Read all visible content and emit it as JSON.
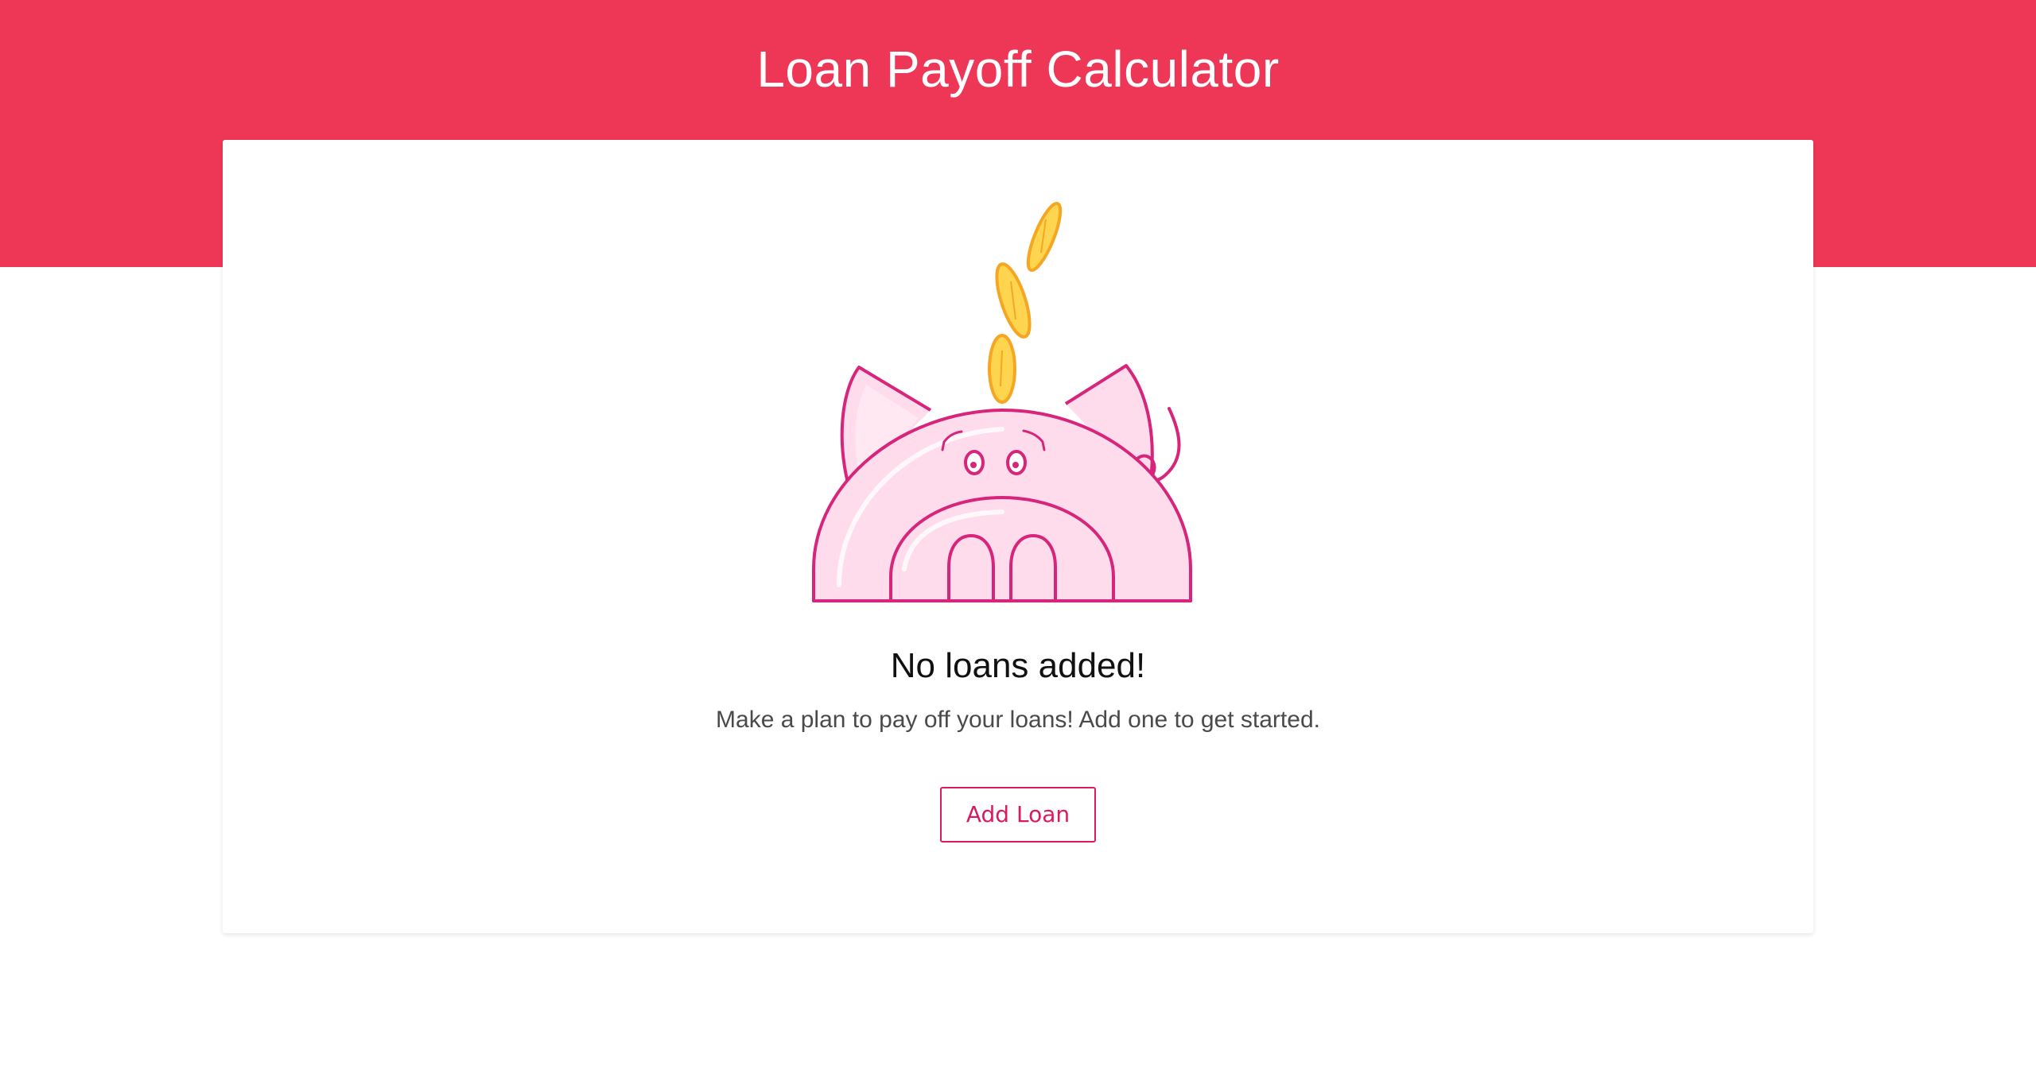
{
  "header": {
    "title": "Loan Payoff Calculator"
  },
  "empty_state": {
    "title": "No loans added!",
    "message": "Make a plan to pay off your loans! Add one to get started.",
    "illustration": "piggy-bank-icon"
  },
  "actions": {
    "add_loan_label": "Add Loan"
  },
  "colors": {
    "brand": "#ee3757",
    "accent": "#d81b60",
    "pig_fill": "#ffdcec",
    "coin": "#ffd54f"
  }
}
